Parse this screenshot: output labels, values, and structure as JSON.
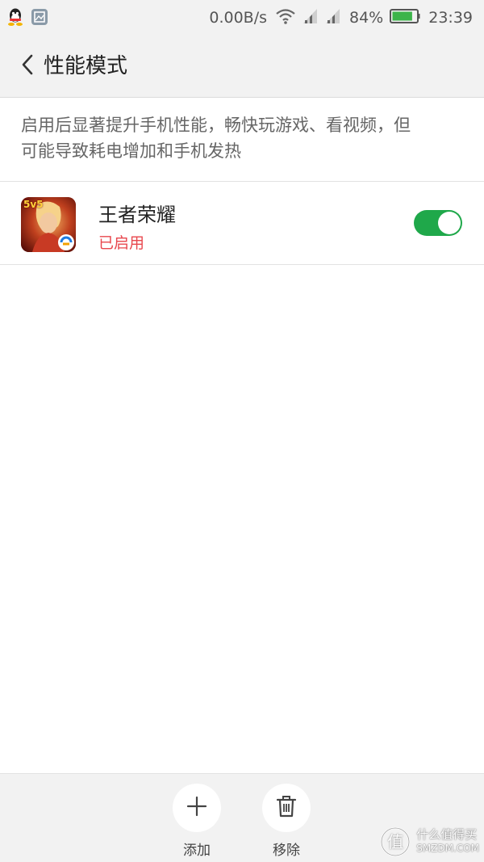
{
  "status_bar": {
    "speed": "0.00B/s",
    "battery_percent": "84%",
    "battery_level": 0.84,
    "time": "23:39",
    "icons": [
      "qq-icon",
      "photo-notification-icon",
      "wifi-icon",
      "signal-icon",
      "signal-icon",
      "battery-icon"
    ]
  },
  "header": {
    "title": "性能模式",
    "back_icon": "chevron-left-icon"
  },
  "description": {
    "line1": "启用后显著提升手机性能，畅快玩游戏、看视频，但",
    "line2": "可能导致耗电增加和手机发热"
  },
  "apps": [
    {
      "name": "王者荣耀",
      "status": "已启用",
      "enabled": true,
      "icon_badge": "5v5"
    }
  ],
  "bottom_bar": {
    "add_label": "添加",
    "remove_label": "移除"
  },
  "watermark": {
    "glyph": "值",
    "line1": "什么值得买",
    "line2": "SMZDM.COM"
  },
  "colors": {
    "accent_green": "#1fa84a",
    "enabled_red": "#e8474d",
    "bar_gray": "#f2f2f2"
  }
}
